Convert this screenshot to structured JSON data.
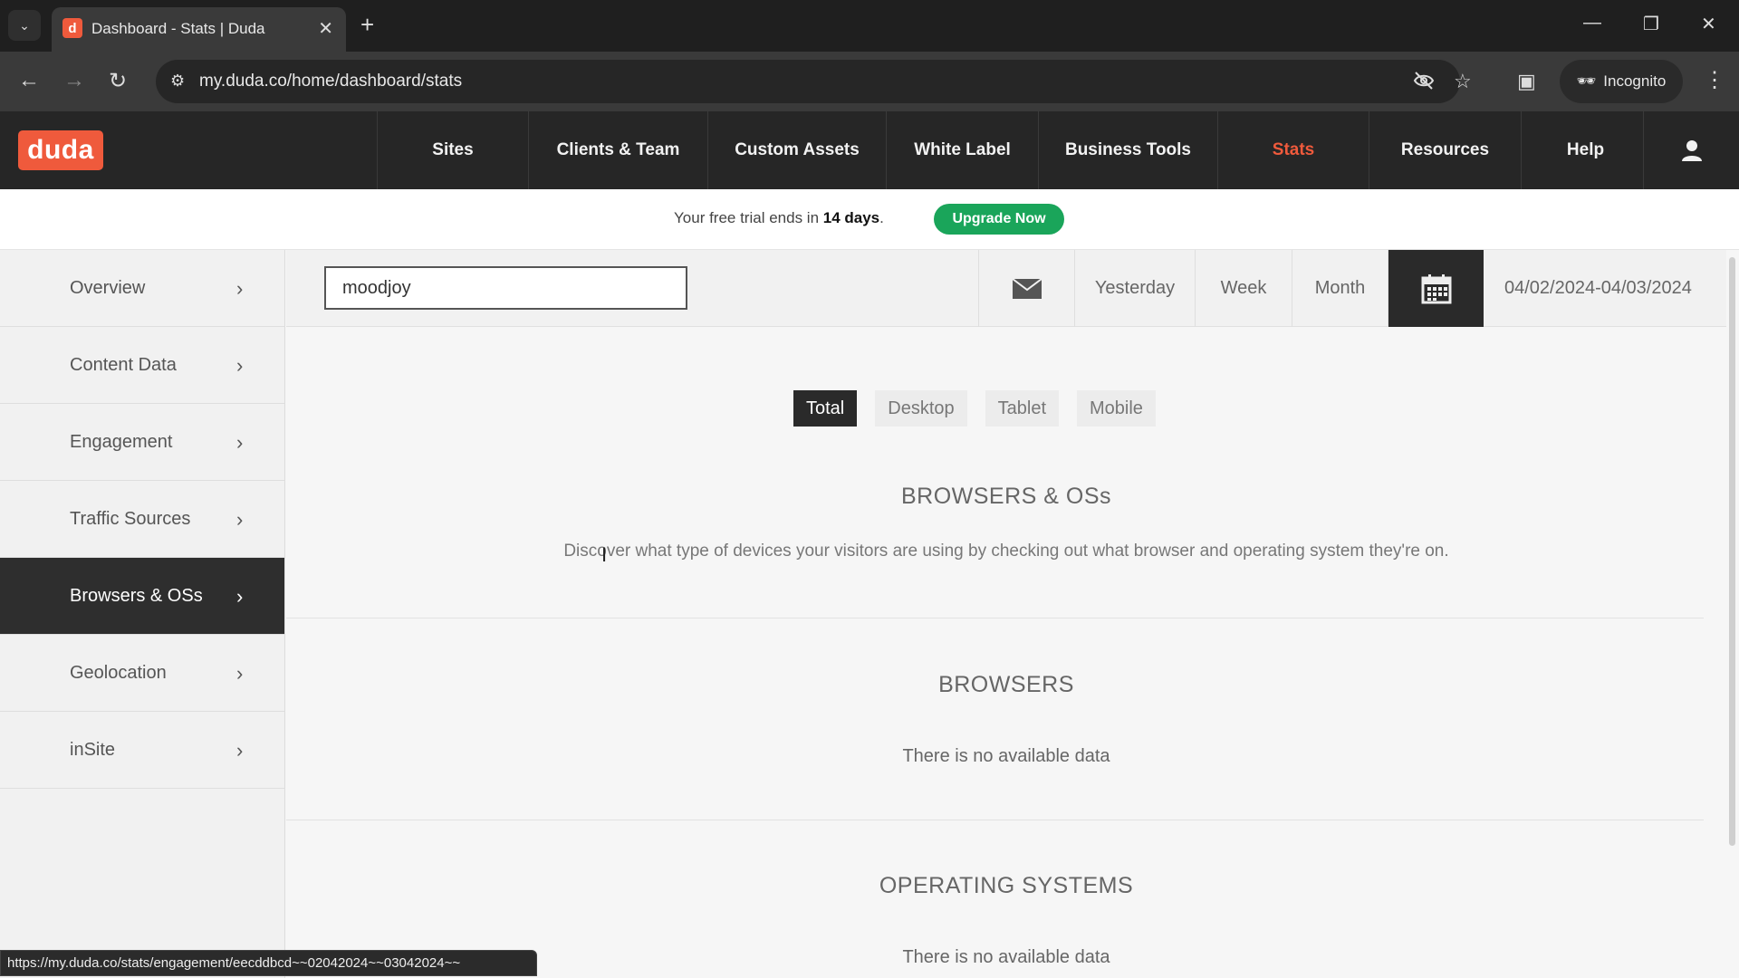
{
  "browser": {
    "tab_title": "Dashboard - Stats | Duda",
    "tab_favicon": "d",
    "url": "my.duda.co/home/dashboard/stats",
    "incognito_label": "Incognito",
    "status_url": "https://my.duda.co/stats/engagement/eecddbcd~~02042024~~03042024~~"
  },
  "header": {
    "logo": "duda",
    "nav": [
      {
        "label": "Sites"
      },
      {
        "label": "Clients & Team"
      },
      {
        "label": "Custom Assets"
      },
      {
        "label": "White Label"
      },
      {
        "label": "Business Tools"
      },
      {
        "label": "Stats",
        "active": true
      },
      {
        "label": "Resources"
      },
      {
        "label": "Help"
      }
    ]
  },
  "trial": {
    "text_before": "Your free trial ends in ",
    "days": "14 days",
    "text_after": ".",
    "button": "Upgrade Now"
  },
  "sidebar": {
    "items": [
      {
        "label": "Overview"
      },
      {
        "label": "Content Data"
      },
      {
        "label": "Engagement"
      },
      {
        "label": "Traffic Sources"
      },
      {
        "label": "Browsers & OSs",
        "active": true
      },
      {
        "label": "Geolocation"
      },
      {
        "label": "inSite"
      }
    ]
  },
  "toolbar": {
    "site_search_value": "moodjoy",
    "yesterday": "Yesterday",
    "week": "Week",
    "month": "Month",
    "date_range": "04/02/2024-04/03/2024"
  },
  "content": {
    "device_tabs": [
      "Total",
      "Desktop",
      "Tablet",
      "Mobile"
    ],
    "active_device_tab": "Total",
    "title": "BROWSERS & OSs",
    "description": "Discover what type of devices your visitors are using by checking out what browser and operating system they're on.",
    "browsers_title": "BROWSERS",
    "browsers_empty": "There is no available data",
    "os_title": "OPERATING SYSTEMS",
    "os_empty": "There is no available data"
  },
  "colors": {
    "brand": "#ef5a3c",
    "upgrade": "#1aa55a",
    "header_bg": "#262626"
  }
}
